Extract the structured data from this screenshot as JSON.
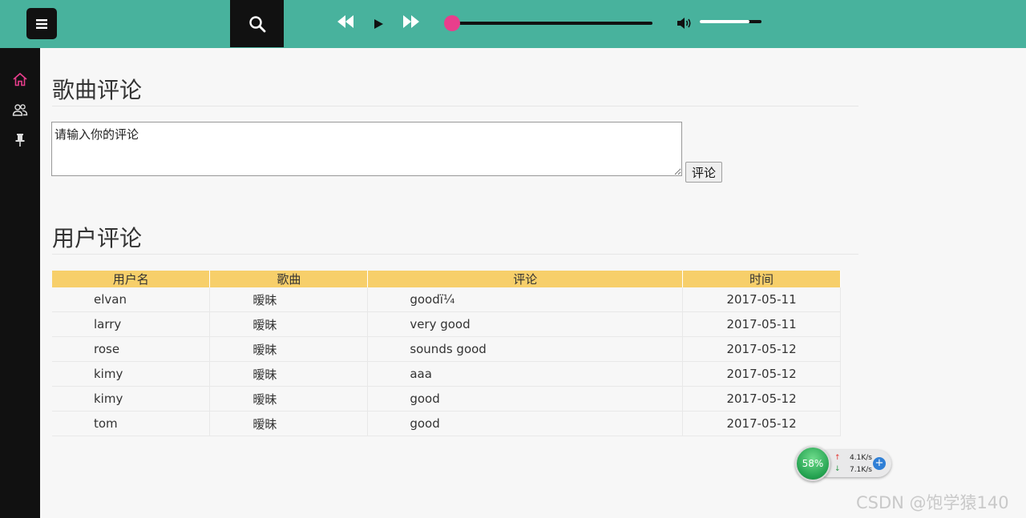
{
  "player": {
    "progress": 0.0,
    "volume": 0.8
  },
  "sidebar": {
    "items": [
      {
        "icon": "home-icon",
        "active": true
      },
      {
        "icon": "users-icon",
        "active": false
      },
      {
        "icon": "pin-icon",
        "active": false
      }
    ]
  },
  "comment_section": {
    "title": "歌曲评论",
    "textarea_value": "请输入你的评论",
    "submit_label": "评论"
  },
  "user_comments": {
    "title": "用户评论",
    "columns": [
      "用户名",
      "歌曲",
      "评论",
      "时间"
    ],
    "rows": [
      [
        "elvan",
        "暧昧",
        "goodï¼",
        "2017-05-11"
      ],
      [
        "larry",
        "暧昧",
        "very good",
        "2017-05-11"
      ],
      [
        "rose",
        "暧昧",
        "sounds good",
        "2017-05-12"
      ],
      [
        "kimy",
        "暧昧",
        "aaa",
        "2017-05-12"
      ],
      [
        "kimy",
        "暧昧",
        "good",
        "2017-05-12"
      ],
      [
        "tom",
        "暧昧",
        "good",
        "2017-05-12"
      ]
    ]
  },
  "net_widget": {
    "percent": "58%",
    "upload": "4.1K/s",
    "download": "7.1K/s"
  },
  "watermark": "CSDN @饱学猿140",
  "colors": {
    "topbar": "#48b29d",
    "accent": "#e83e8c",
    "table_header": "#f7cf6a",
    "sidebar": "#111111"
  }
}
